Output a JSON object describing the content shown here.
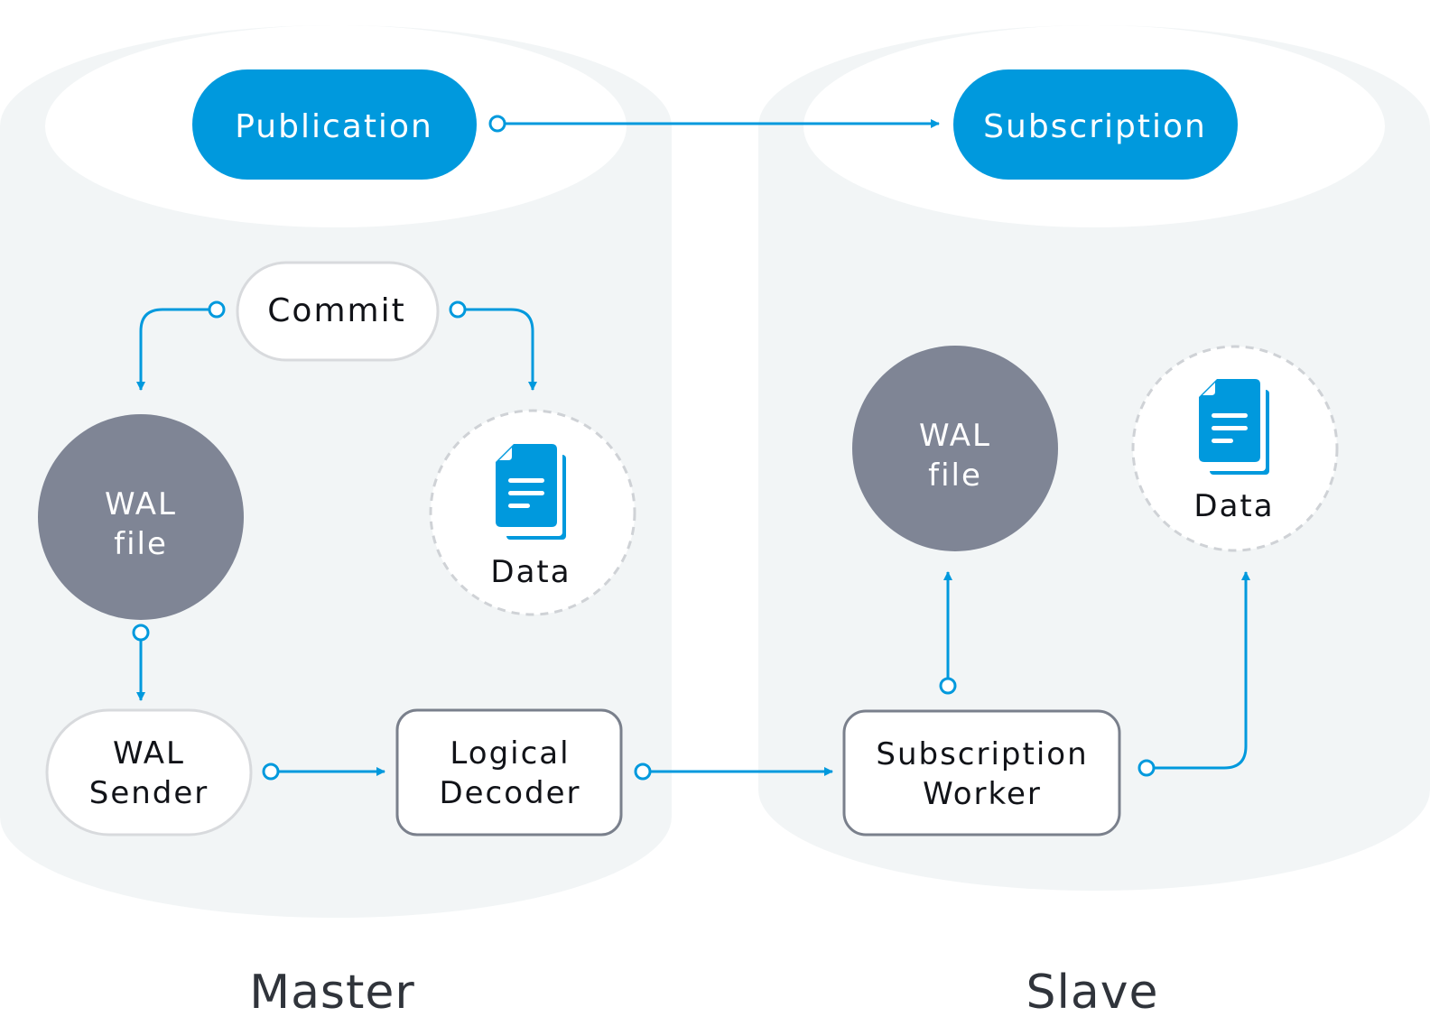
{
  "colors": {
    "accent": "#0099dd",
    "cylinder": "#f2f5f6",
    "wal_circle": "#7f8595",
    "node_border": "#d8dadd",
    "box_border": "#7a808c",
    "dashed_border": "#cfd2d6",
    "text": "#111318",
    "cylinder_label": "#30343b"
  },
  "master": {
    "label": "Master",
    "publication": "Publication",
    "commit": "Commit",
    "wal_file": [
      "WAL",
      "file"
    ],
    "data": "Data",
    "wal_sender": [
      "WAL",
      "Sender"
    ],
    "logical_decoder": [
      "Logical",
      "Decoder"
    ]
  },
  "slave": {
    "label": "Slave",
    "subscription": "Subscription",
    "wal_file": [
      "WAL",
      "file"
    ],
    "data": "Data",
    "subscription_worker": [
      "Subscription",
      "Worker"
    ]
  },
  "connections": [
    {
      "from": "Publication",
      "to": "Subscription"
    },
    {
      "from": "Commit",
      "to": "WAL file (Master)"
    },
    {
      "from": "Commit",
      "to": "Data (Master)"
    },
    {
      "from": "WAL file (Master)",
      "to": "WAL Sender"
    },
    {
      "from": "WAL Sender",
      "to": "Logical Decoder"
    },
    {
      "from": "Logical Decoder",
      "to": "Subscription Worker"
    },
    {
      "from": "Subscription Worker",
      "to": "WAL file (Slave)"
    },
    {
      "from": "Subscription Worker",
      "to": "Data (Slave)"
    }
  ]
}
